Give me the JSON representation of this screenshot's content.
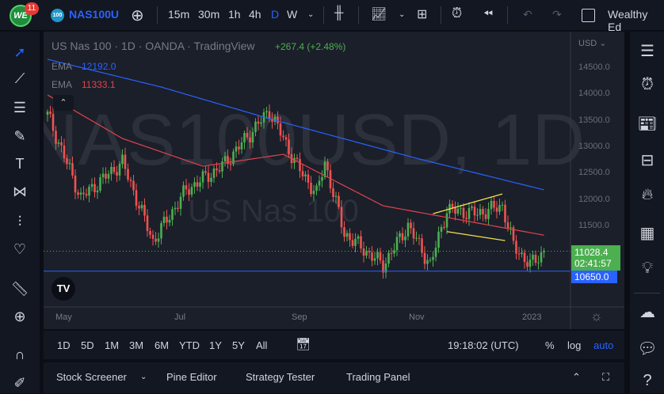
{
  "topbar": {
    "notifications": "11",
    "logo_text": "WE",
    "symbol_badge": "100",
    "symbol": "NAS100U",
    "timeframes": [
      "15m",
      "30m",
      "1h",
      "4h",
      "D",
      "W"
    ],
    "active_timeframe": "D",
    "account": "Wealthy Ed"
  },
  "legend": {
    "title": "US Nas 100 · 1D · OANDA · TradingView",
    "change": "+267.4 (+2.48%)",
    "ema1_label": "EMA",
    "ema1_value": "12192.0",
    "ema2_label": "EMA",
    "ema2_value": "11333.1"
  },
  "watermark": {
    "line1": "NAS100USD, 1D",
    "line2": "US Nas 100"
  },
  "price_axis": {
    "currency": "USD",
    "ticks": [
      "14500.0",
      "14000.0",
      "13500.0",
      "13000.0",
      "12500.0",
      "12000.0",
      "11500.0"
    ],
    "last_price": "11028.4",
    "countdown": "02:41:57",
    "line_price": "10650.0"
  },
  "time_axis": {
    "labels": [
      "May",
      "Jul",
      "Sep",
      "Nov",
      "2023"
    ]
  },
  "range_bar": {
    "ranges": [
      "1D",
      "5D",
      "1M",
      "3M",
      "6M",
      "YTD",
      "1Y",
      "5Y",
      "All"
    ],
    "clock": "19:18:02 (UTC)",
    "percent": "%",
    "log": "log",
    "auto": "auto"
  },
  "bottom_tabs": [
    "Stock Screener",
    "Pine Editor",
    "Strategy Tester",
    "Trading Panel"
  ],
  "colors": {
    "up": "#26a69a",
    "up2": "#4caf50",
    "down": "#ef5350",
    "ema_blue": "#2962ff",
    "ema_red": "#e0434b",
    "trend": "#f2e14c",
    "accent": "#2962ff"
  },
  "chart_data": {
    "type": "candlestick",
    "symbol": "NAS100USD",
    "interval": "1D",
    "ylim": [
      10150,
      14900
    ],
    "price_anchors": [
      [
        0,
        13615
      ],
      [
        12,
        12040
      ],
      [
        27,
        12715
      ],
      [
        38,
        11215
      ],
      [
        50,
        12190
      ],
      [
        63,
        12640
      ],
      [
        80,
        13690
      ],
      [
        90,
        12640
      ],
      [
        97,
        12115
      ],
      [
        100,
        12715
      ],
      [
        107,
        11365
      ],
      [
        121,
        10765
      ],
      [
        130,
        11515
      ],
      [
        138,
        10765
      ],
      [
        144,
        11815
      ],
      [
        155,
        11740
      ],
      [
        164,
        11890
      ],
      [
        168,
        11140
      ],
      [
        174,
        10765
      ],
      [
        179,
        11028
      ]
    ],
    "ema_blue_anchors": [
      [
        0,
        14665
      ],
      [
        41,
        14140
      ],
      [
        80,
        13540
      ],
      [
        133,
        12790
      ],
      [
        179,
        12192
      ]
    ],
    "ema_red_anchors": [
      [
        0,
        13990
      ],
      [
        27,
        13165
      ],
      [
        56,
        12640
      ],
      [
        85,
        12865
      ],
      [
        121,
        11890
      ],
      [
        179,
        11333
      ]
    ],
    "trendlines": [
      [
        [
          139,
          11740
        ],
        [
          164,
          12115
        ]
      ],
      [
        [
          144,
          11400
        ],
        [
          165,
          11230
        ]
      ]
    ]
  }
}
